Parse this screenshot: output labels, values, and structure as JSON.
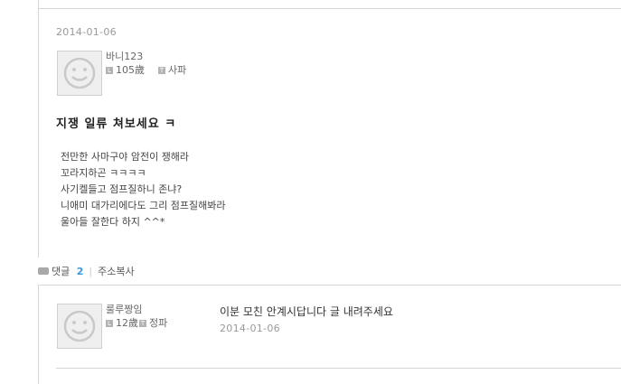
{
  "post": {
    "date": "2014-01-06",
    "author": {
      "name": "바니123",
      "age": "105歲",
      "type": "사파"
    },
    "title": "지쟁 일류 쳐보세요 ㅋ",
    "body": [
      "전만한 사마구야 암전이 쟁해라",
      "꼬라지하곤 ㅋㅋㅋㅋ",
      "사기켈들고 점프질하니 존냐?",
      "니애미 대가리에다도 그리 점프질해봐라",
      "울아들 잘한다 하지 ^^*"
    ]
  },
  "actions": {
    "comment_label": "댓글",
    "comment_count": "2",
    "copy_url_label": "주소복사"
  },
  "comments": [
    {
      "author": {
        "name": "룰루짱임",
        "age": "12歲",
        "type": "정파"
      },
      "text": "이분 모친 안계시답니다 글 내려주세요",
      "date": "2014-01-06"
    }
  ],
  "icons": {
    "avatar": "default-avatar-icon",
    "age_tag": "level-tag-icon",
    "type_tag": "type-tag-icon",
    "comment": "comment-bubble-icon"
  }
}
